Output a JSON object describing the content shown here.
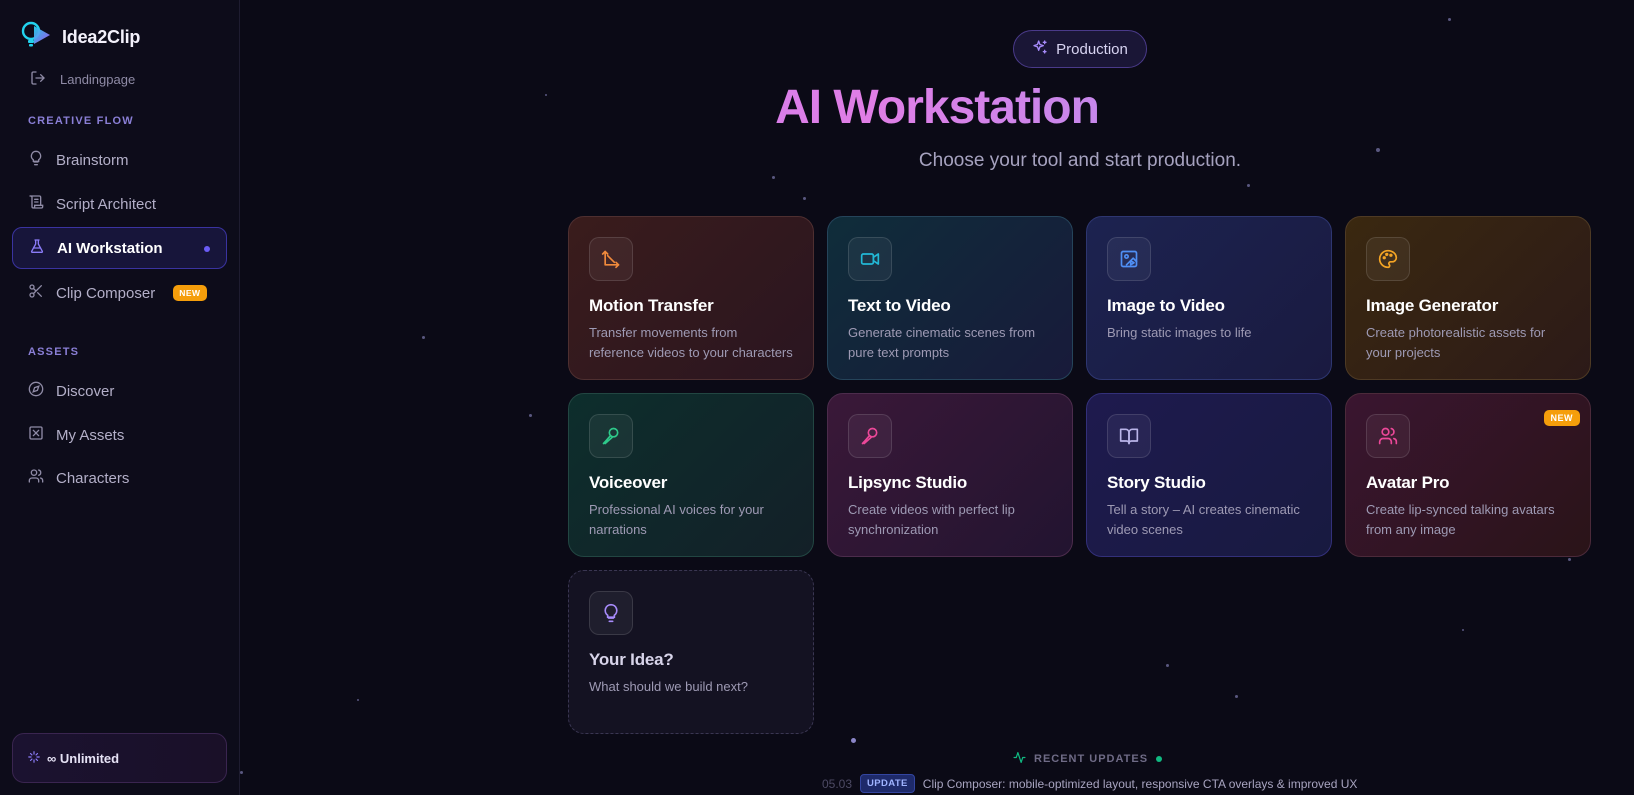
{
  "app": {
    "name": "Idea2Clip"
  },
  "sidebar": {
    "landing": "Landingpage",
    "sections": [
      {
        "label": "CREATIVE FLOW"
      },
      {
        "label": "ASSETS"
      }
    ],
    "items": [
      {
        "label": "Brainstorm",
        "icon": "lightbulb-icon"
      },
      {
        "label": "Script Architect",
        "icon": "script-icon"
      },
      {
        "label": "AI Workstation",
        "icon": "flask-icon",
        "active": true
      },
      {
        "label": "Clip Composer",
        "icon": "scissors-icon",
        "badge": "NEW"
      },
      {
        "label": "Discover",
        "icon": "compass-icon"
      },
      {
        "label": "My Assets",
        "icon": "assets-icon"
      },
      {
        "label": "Characters",
        "icon": "users-icon"
      }
    ],
    "plan": "∞ Unlimited"
  },
  "header": {
    "pill": "Production",
    "title": "AI Workstation",
    "subtitle": "Choose your tool and start production."
  },
  "tools": [
    {
      "title": "Motion Transfer",
      "desc": "Transfer movements from reference videos to your characters",
      "icon": "axis-arrows-icon",
      "color": "#f08a3c"
    },
    {
      "title": "Text to Video",
      "desc": "Generate cinematic scenes from pure text prompts",
      "icon": "video-camera-icon",
      "color": "#22b8d6"
    },
    {
      "title": "Image to Video",
      "desc": "Bring static images to life",
      "icon": "image-play-icon",
      "color": "#4f8ff5"
    },
    {
      "title": "Image Generator",
      "desc": "Create photorealistic assets for your projects",
      "icon": "palette-icon",
      "color": "#f5a524"
    },
    {
      "title": "Voiceover",
      "desc": "Professional AI voices for your narrations",
      "icon": "microphone-icon",
      "color": "#2ec98a"
    },
    {
      "title": "Lipsync Studio",
      "desc": "Create videos with perfect lip synchronization",
      "icon": "microphone-icon",
      "color": "#ec4899"
    },
    {
      "title": "Story Studio",
      "desc": "Tell a story – AI creates cinematic video scenes",
      "icon": "book-open-icon",
      "color": "#b9b4e8"
    },
    {
      "title": "Avatar Pro",
      "desc": "Create lip-synced talking avatars from any image",
      "icon": "users-icon",
      "color": "#ec4899",
      "badge": "NEW"
    },
    {
      "title": "Your Idea?",
      "desc": "What should we build next?",
      "icon": "lightbulb-icon",
      "color": "#a78bfa"
    }
  ],
  "updates": {
    "label": "RECENT UPDATES",
    "date": "05.03",
    "tag": "UPDATE",
    "text": "Clip Composer: mobile-optimized layout, responsive CTA overlays & improved UX"
  }
}
